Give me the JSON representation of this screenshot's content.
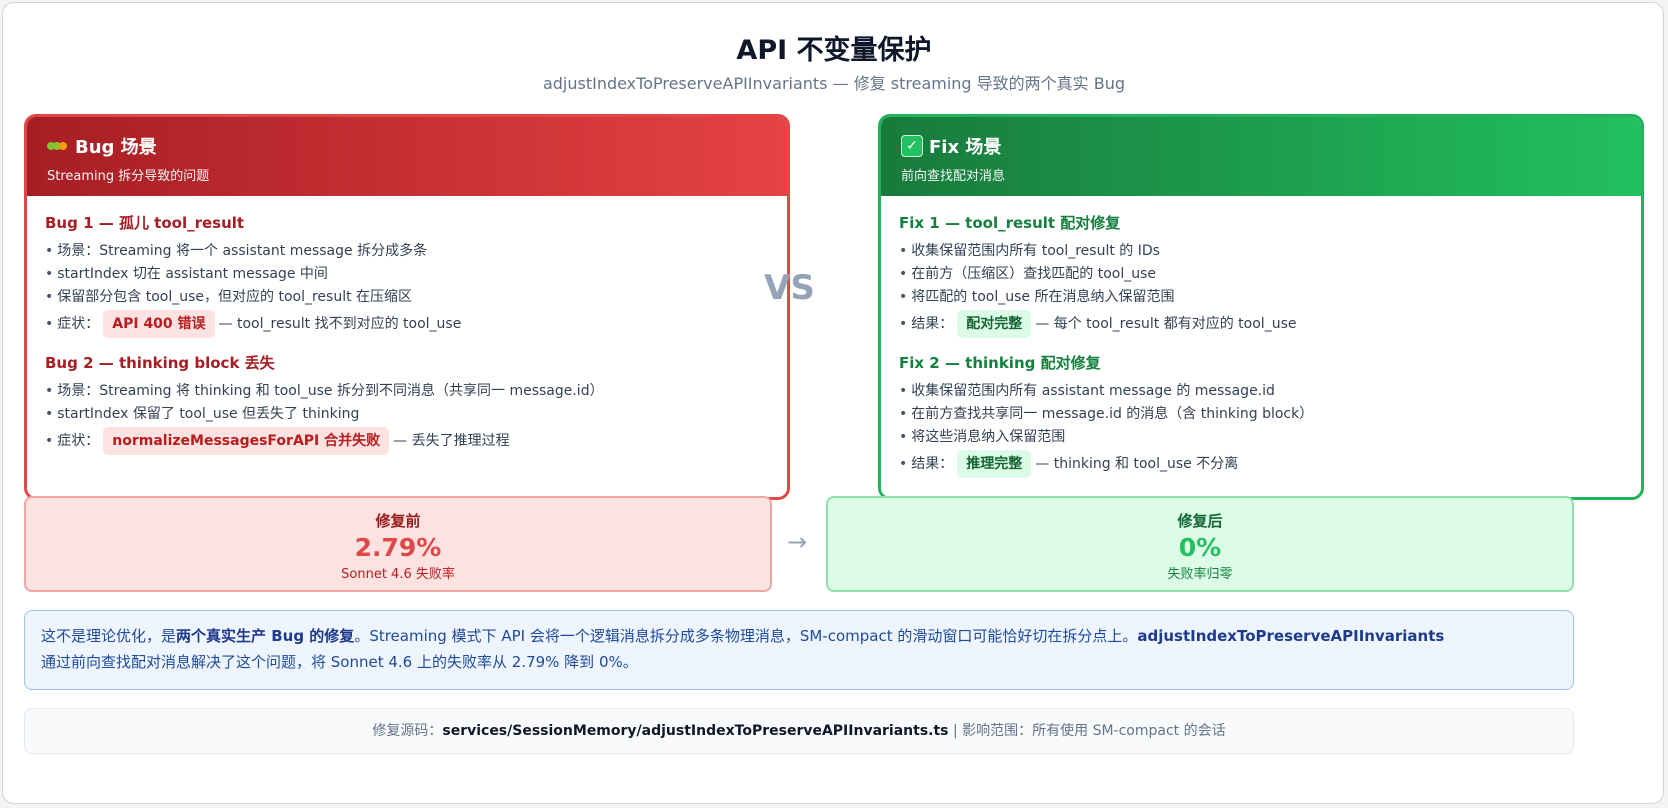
{
  "header": {
    "title": "API 不变量保护",
    "subtitle": "adjustIndexToPreserveAPIInvariants — 修复 streaming 导致的两个真实 Bug"
  },
  "bug_card": {
    "icon": "caterpillar-bug-icon",
    "title": "Bug 场景",
    "subtitle": "Streaming 拆分导致的问题",
    "sections": [
      {
        "title": "Bug 1 — 孤儿 tool_result",
        "items": [
          "场景：Streaming 将一个 assistant message 拆分成多条",
          "startIndex 切在 assistant message 中间",
          "保留部分包含 tool_use，但对应的 tool_result 在压缩区"
        ],
        "symptom_label": "症状：",
        "symptom_chip": "API 400 错误",
        "symptom_text": "— tool_result 找不到对应的 tool_use"
      },
      {
        "title": "Bug 2 — thinking block 丢失",
        "items": [
          "场景：Streaming 将 thinking 和 tool_use 拆分到不同消息（共享同一 message.id）",
          "startIndex 保留了 tool_use 但丢失了 thinking"
        ],
        "symptom_label": "症状：",
        "symptom_chip": "normalizeMessagesForAPI 合并失败",
        "symptom_text": "— 丢失了推理过程"
      }
    ]
  },
  "vs_label": "VS",
  "fix_card": {
    "icon": "check-mark-icon",
    "title": "Fix 场景",
    "subtitle": "前向查找配对消息",
    "sections": [
      {
        "title": "Fix 1 — tool_result 配对修复",
        "items": [
          "收集保留范围内所有 tool_result 的 IDs",
          "在前方（压缩区）查找匹配的 tool_use",
          "将匹配的 tool_use 所在消息纳入保留范围"
        ],
        "result_label": "结果：",
        "result_chip": "配对完整",
        "result_text": "— 每个 tool_result 都有对应的 tool_use"
      },
      {
        "title": "Fix 2 — thinking 配对修复",
        "items": [
          "收集保留范围内所有 assistant message 的 message.id",
          "在前方查找共享同一 message.id 的消息（含 thinking block）",
          "将这些消息纳入保留范围"
        ],
        "result_label": "结果：",
        "result_chip": "推理完整",
        "result_text": "— thinking 和 tool_use 不分离"
      }
    ]
  },
  "stats": {
    "before": {
      "label": "修复前",
      "value": "2.79%",
      "note": "Sonnet 4.6 失败率"
    },
    "arrow": "→",
    "after": {
      "label": "修复后",
      "value": "0%",
      "note": "失败率归零"
    }
  },
  "note": {
    "p1": "这不是理论优化，是",
    "b1": "两个真实生产 Bug 的修复",
    "p2": "。Streaming 模式下 API 会将一个逻辑消息拆分成多条物理消息，SM-compact 的滑动窗口可能恰好切在拆分点上。",
    "b2": "adjustIndexToPreserveAPIInvariants",
    "p3": "通过前向查找配对消息解决了这个问题，将 Sonnet 4.6 上的失败率从 2.79% 降到 0%。"
  },
  "footer": {
    "source_label": "修复源码：",
    "source_path": "services/SessionMemory/adjustIndexToPreserveAPIInvariants.ts",
    "separator": "|",
    "scope_label": "影响范围：",
    "scope_value": "所有使用 SM-compact 的会话"
  },
  "colors": {
    "bug_accent": "#e04848",
    "fix_accent": "#22c05e",
    "note_bg": "#eef5ff"
  }
}
